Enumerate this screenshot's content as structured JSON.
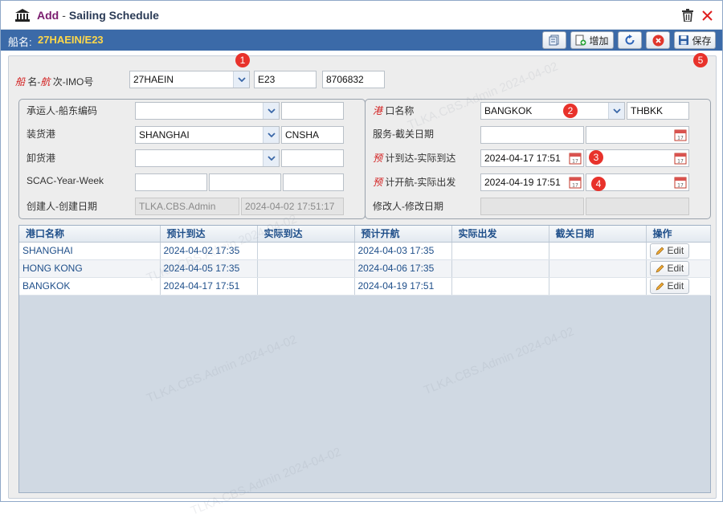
{
  "window": {
    "title_add": "Add",
    "title_sep": "-",
    "title_main": "Sailing Schedule",
    "icons": {
      "app": "bank-icon",
      "delete": "trash-icon",
      "close": "close-icon"
    }
  },
  "toolbar": {
    "ship_label": "船名:",
    "ship_value": "27HAEIN/E23",
    "add_label": "增加",
    "save_label": "保存"
  },
  "form": {
    "row1": {
      "label_a": "船",
      "label_b": "名-",
      "label_c": "航",
      "label_d": "次-IMO号",
      "vessel": "27HAEIN",
      "voyage": "E23",
      "imo": "8706832"
    },
    "left": {
      "carrier_label": "承运人-船东编码",
      "carrier_value": "",
      "owner_code": "",
      "load_label": "装货港",
      "load_value": "SHANGHAI",
      "load_code": "CNSHA",
      "discharge_label": "卸货港",
      "discharge_value": "",
      "discharge_code": "",
      "scac_label": "SCAC-Year-Week",
      "scac_value": "",
      "year_value": "",
      "week_value": "",
      "creator_label": "创建人-创建日期",
      "creator_value": "TLKA.CBS.Admin",
      "created_date": "2024-04-02 17:51:17"
    },
    "right": {
      "port_label_a": "港",
      "port_label_b": "口名称",
      "port_value": "BANGKOK",
      "port_code": "THBKK",
      "service_label": "服务-截关日期",
      "service_value": "",
      "cutoff_value": "",
      "eta_label_a": "预",
      "eta_label_b": "计到达-实际到达",
      "eta_value": "2024-04-17 17:51",
      "ata_value": "",
      "etd_label_a": "预",
      "etd_label_b": "计开航-实际出发",
      "etd_value": "2024-04-19 17:51",
      "atd_value": "",
      "modifier_label": "修改人-修改日期",
      "modifier_value": "",
      "modified_date": ""
    }
  },
  "badges": [
    "1",
    "2",
    "3",
    "4",
    "5"
  ],
  "table": {
    "columns": [
      "港口名称",
      "预计到达",
      "实际到达",
      "预计开航",
      "实际出发",
      "截关日期",
      "操作"
    ],
    "rows": [
      {
        "port": "SHANGHAI",
        "eta": "2024-04-02 17:35",
        "ata": "",
        "etd": "2024-04-03 17:35",
        "atd": "",
        "cutoff": "",
        "action": "Edit"
      },
      {
        "port": "HONG KONG",
        "eta": "2024-04-05 17:35",
        "ata": "",
        "etd": "2024-04-06 17:35",
        "atd": "",
        "cutoff": "",
        "action": "Edit"
      },
      {
        "port": "BANGKOK",
        "eta": "2024-04-17 17:51",
        "ata": "",
        "etd": "2024-04-19 17:51",
        "atd": "",
        "cutoff": "",
        "action": "Edit"
      }
    ]
  },
  "watermark": "TLKA.CBS.Admin 2024-04-02",
  "colors": {
    "toolbar": "#3b6aa8",
    "ship_value": "#ffd84a",
    "badge": "#e8322b",
    "link": "#1f4f8a"
  }
}
